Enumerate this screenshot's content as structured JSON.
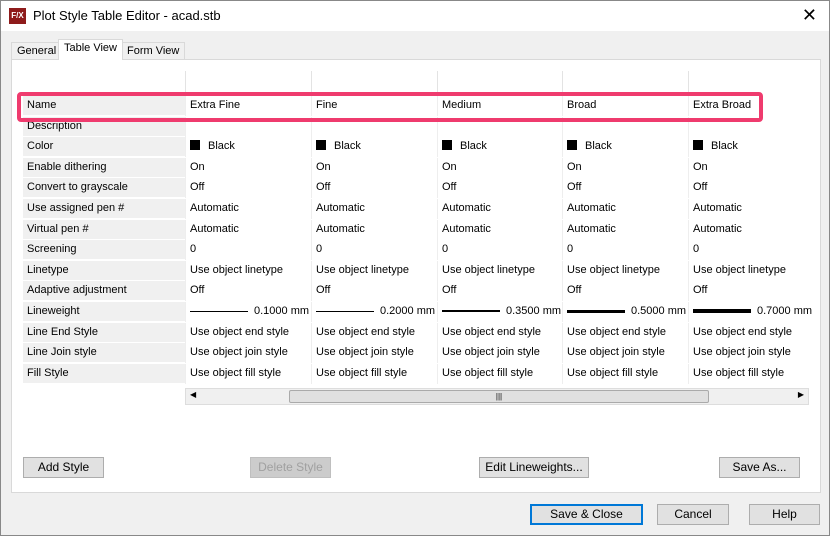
{
  "window": {
    "title": "Plot Style Table Editor - acad.stb",
    "icon": "F/X"
  },
  "tabs": [
    "General",
    "Table View",
    "Form View"
  ],
  "active_tab": "Table View",
  "table": {
    "rows": [
      {
        "label": "Name",
        "values": [
          "Extra Fine",
          "Fine",
          "Medium",
          "Broad",
          "Extra Broad"
        ]
      },
      {
        "label": "Description",
        "values": [
          "",
          "",
          "",
          "",
          ""
        ]
      },
      {
        "label": "Color",
        "values": [
          "Black",
          "Black",
          "Black",
          "Black",
          "Black"
        ],
        "swatch": "#000000"
      },
      {
        "label": "Enable dithering",
        "values": [
          "On",
          "On",
          "On",
          "On",
          "On"
        ]
      },
      {
        "label": "Convert to grayscale",
        "values": [
          "Off",
          "Off",
          "Off",
          "Off",
          "Off"
        ]
      },
      {
        "label": "Use assigned pen #",
        "values": [
          "Automatic",
          "Automatic",
          "Automatic",
          "Automatic",
          "Automatic"
        ]
      },
      {
        "label": "Virtual pen #",
        "values": [
          "Automatic",
          "Automatic",
          "Automatic",
          "Automatic",
          "Automatic"
        ]
      },
      {
        "label": "Screening",
        "values": [
          "0",
          "0",
          "0",
          "0",
          "0"
        ]
      },
      {
        "label": "Linetype",
        "values": [
          "Use object linetype",
          "Use object linetype",
          "Use object linetype",
          "Use object linetype",
          "Use object linetype"
        ]
      },
      {
        "label": "Adaptive adjustment",
        "values": [
          "Off",
          "Off",
          "Off",
          "Off",
          "Off"
        ]
      },
      {
        "label": "Lineweight",
        "values": [
          "0.1000 mm",
          "0.2000 mm",
          "0.3500 mm",
          "0.5000 mm",
          "0.7000 mm"
        ],
        "lineweights_mm": [
          0.1,
          0.2,
          0.35,
          0.5,
          0.7
        ]
      },
      {
        "label": "Line End Style",
        "values": [
          "Use object end style",
          "Use object end style",
          "Use object end style",
          "Use object end style",
          "Use object end style"
        ]
      },
      {
        "label": "Line Join style",
        "values": [
          "Use object join style",
          "Use object join style",
          "Use object join style",
          "Use object join style",
          "Use object join style"
        ]
      },
      {
        "label": "Fill Style",
        "values": [
          "Use object fill style",
          "Use object fill style",
          "Use object fill style",
          "Use object fill style",
          "Use object fill style"
        ]
      }
    ]
  },
  "highlight_color": "#ef3b6e",
  "panel_buttons": {
    "add": "Add Style",
    "delete": "Delete Style",
    "edit": "Edit Lineweights...",
    "saveas": "Save As..."
  },
  "dialog_buttons": {
    "save_close": "Save & Close",
    "cancel": "Cancel",
    "help": "Help"
  }
}
